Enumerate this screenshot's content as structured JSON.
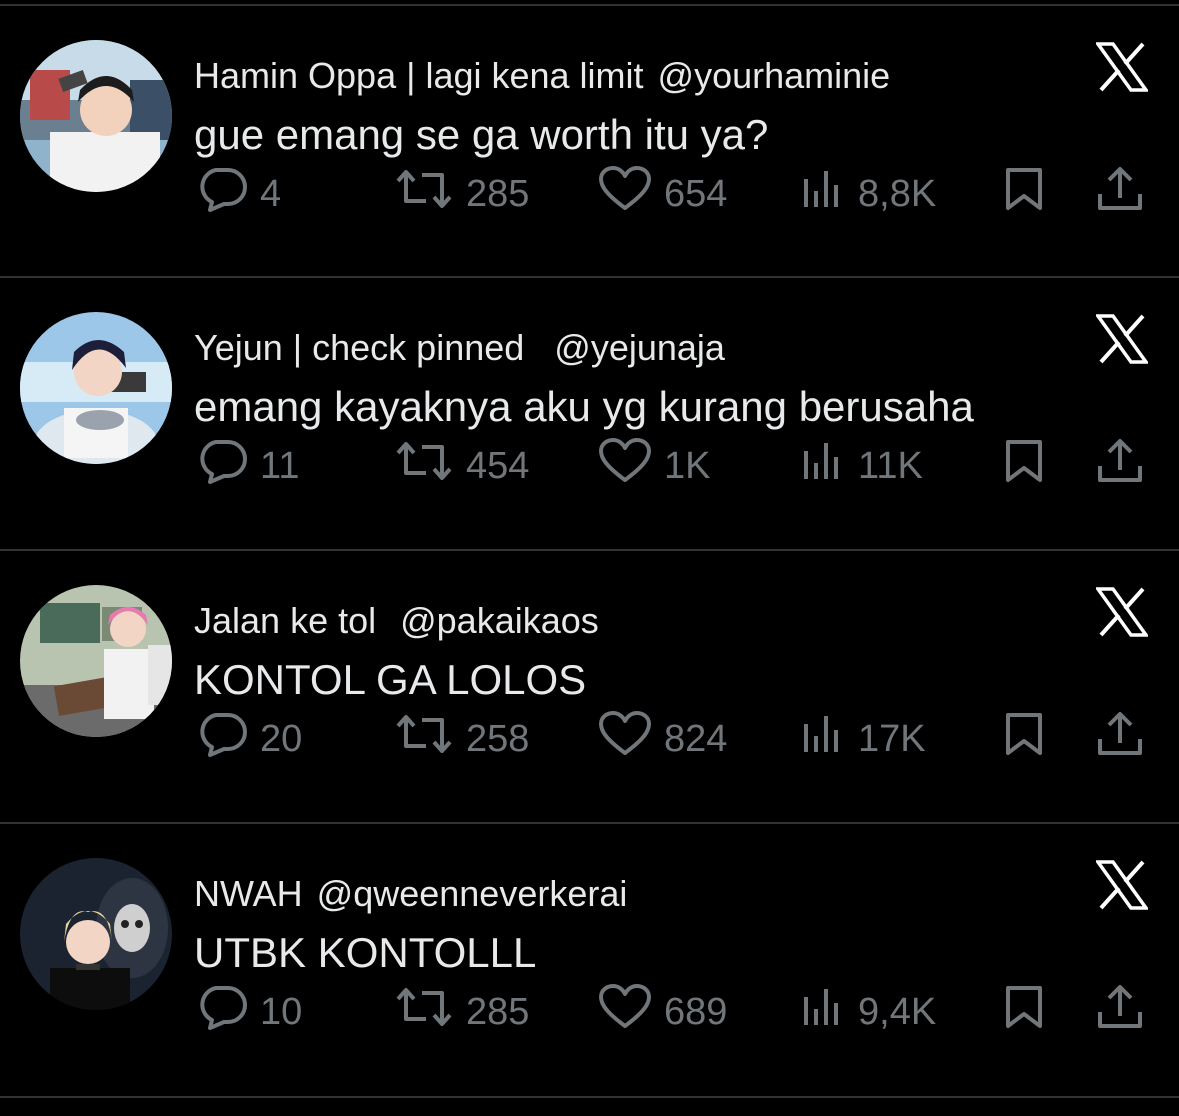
{
  "feed": {
    "tweets": [
      {
        "name": "Hamin Oppa | lagi kena limit",
        "handle": "@yourhaminie",
        "text": "gue emang se ga worth itu ya?",
        "replies": "4",
        "retweets": "285",
        "likes": "654",
        "views": "8,8K"
      },
      {
        "name": "Yejun | check pinned",
        "handle": "@yejunaja",
        "text": "emang kayaknya aku yg kurang berusaha",
        "replies": "11",
        "retweets": "454",
        "likes": "1K",
        "views": "11K"
      },
      {
        "name": "Jalan ke tol",
        "handle": "@pakaikaos",
        "text": "KONTOL GA LOLOS",
        "replies": "20",
        "retweets": "258",
        "likes": "824",
        "views": "17K"
      },
      {
        "name": "NWAH",
        "handle": "@qweenneverkerai",
        "text": "UTBK KONTOLLL",
        "replies": "10",
        "retweets": "285",
        "likes": "689",
        "views": "9,4K"
      }
    ]
  },
  "icons": {
    "reply": "reply-icon",
    "retweet": "retweet-icon",
    "like": "heart-icon",
    "views": "views-icon",
    "bookmark": "bookmark-icon",
    "share": "share-icon",
    "brand": "x-logo-icon"
  },
  "colors": {
    "background": "#000000",
    "text": "#e7e9ea",
    "muted": "#71767b",
    "divider": "#2f3336"
  }
}
